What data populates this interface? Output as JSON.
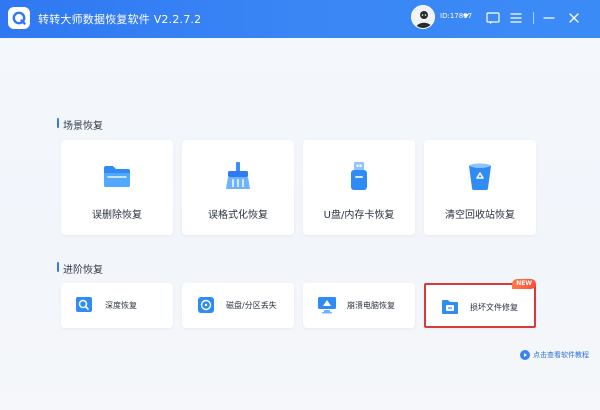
{
  "app": {
    "title": "转转大师数据恢复软件 V2.2.7.2",
    "user_id": "ID:17807"
  },
  "sections": {
    "scene": {
      "title": "场景恢复",
      "cards": [
        {
          "label": "误删除恢复",
          "icon": "folder-icon"
        },
        {
          "label": "误格式化恢复",
          "icon": "broom-icon"
        },
        {
          "label": "U盘/内存卡恢复",
          "icon": "usb-drive-icon"
        },
        {
          "label": "清空回收站恢复",
          "icon": "recycle-bin-icon"
        }
      ]
    },
    "advanced": {
      "title": "进阶恢复",
      "cards": [
        {
          "label": "深度恢复",
          "icon": "deep-scan-icon"
        },
        {
          "label": "磁盘/分区丢失",
          "icon": "disk-icon"
        },
        {
          "label": "崩溃电脑恢复",
          "icon": "crashed-computer-icon"
        },
        {
          "label": "损坏文件修复",
          "icon": "file-repair-icon",
          "badge": "NEW"
        }
      ]
    }
  },
  "help": {
    "label": "点击查看软件教程"
  },
  "colors": {
    "titlebar": "#3a86f5",
    "accent": "#2f7bf2",
    "highlight_border": "#d63a3a"
  }
}
